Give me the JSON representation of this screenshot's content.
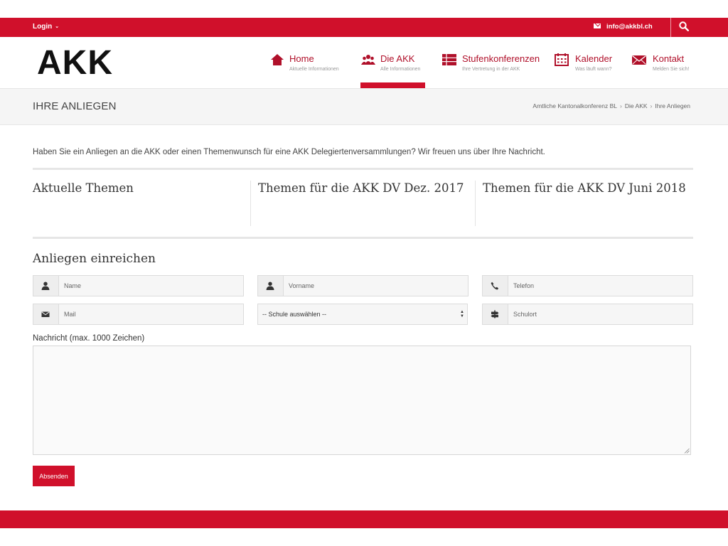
{
  "topbar": {
    "login_label": "Login",
    "email": "info@akkbl.ch"
  },
  "header": {
    "logo_text": "AKK",
    "nav": [
      {
        "label": "Home",
        "sub": "Aktuelle Informationen",
        "icon": "home-icon"
      },
      {
        "label": "Die AKK",
        "sub": "Alle Informationen",
        "icon": "people-icon",
        "active": true
      },
      {
        "label": "Stufenkonferenzen",
        "sub": "Ihre Vertretung in der AKK",
        "icon": "table-icon"
      },
      {
        "label": "Kalender",
        "sub": "Was läuft wann?",
        "icon": "calendar-icon"
      },
      {
        "label": "Kontakt",
        "sub": "Melden Sie sich!",
        "icon": "envelope-icon"
      }
    ]
  },
  "titlebar": {
    "title": "IHRE ANLIEGEN",
    "breadcrumbs": [
      "Amtliche Kantonalkonferenz BL",
      "Die AKK",
      "Ihre Anliegen"
    ]
  },
  "main": {
    "intro": "Haben Sie ein Anliegen an die AKK oder einen Themenwunsch für eine AKK Delegiertenversammlungen? Wir freuen uns über Ihre Nachricht.",
    "columns": [
      "Aktuelle Themen",
      "Themen für die AKK DV Dez. 2017",
      "Themen für die AKK DV Juni 2018"
    ],
    "form_title": "Anliegen einreichen",
    "form": {
      "name_placeholder": "Name",
      "vorname_placeholder": "Vorname",
      "telefon_placeholder": "Telefon",
      "mail_placeholder": "Mail",
      "schule_selected": "-- Schule auswählen --",
      "schulort_placeholder": "Schulort",
      "message_label": "Nachricht (max. 1000 Zeichen)",
      "submit_label": "Absenden"
    }
  },
  "colors": {
    "brand_red": "#d0102b",
    "nav_text": "#b0102a"
  }
}
